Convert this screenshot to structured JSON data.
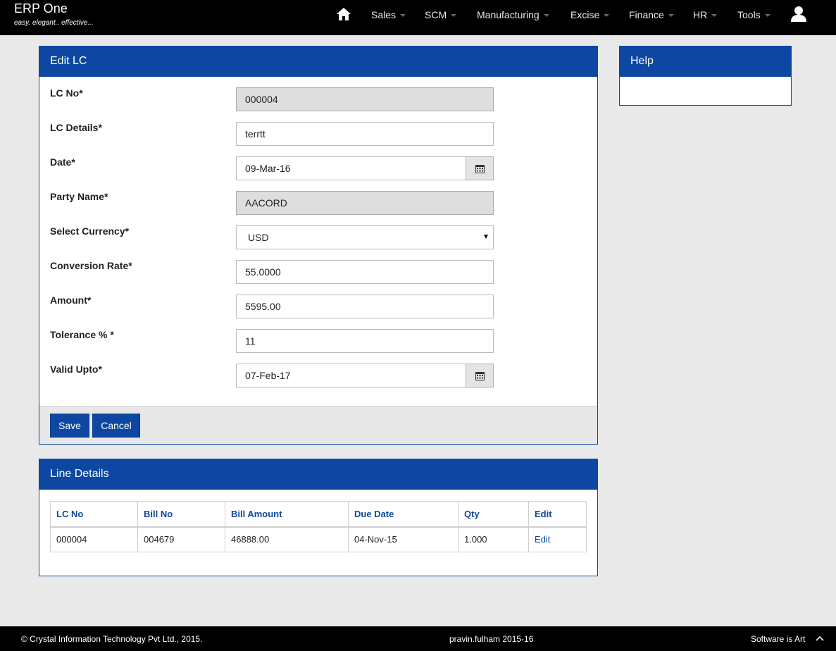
{
  "app": {
    "title": "ERP One",
    "tagline": "easy. elegant.. effective..."
  },
  "nav": {
    "items": [
      {
        "label": "Sales"
      },
      {
        "label": "SCM"
      },
      {
        "label": "Manufacturing"
      },
      {
        "label": "Excise"
      },
      {
        "label": "Finance"
      },
      {
        "label": "HR"
      },
      {
        "label": "Tools"
      }
    ]
  },
  "edit_panel": {
    "title": "Edit LC",
    "fields": {
      "lc_no": {
        "label": "LC No*",
        "value": "000004"
      },
      "lc_details": {
        "label": "LC Details*",
        "value": "terrtt"
      },
      "date": {
        "label": "Date*",
        "value": "09-Mar-16"
      },
      "party_name": {
        "label": "Party Name*",
        "value": "AACORD"
      },
      "currency": {
        "label": "Select Currency*",
        "value": "USD"
      },
      "conversion_rate": {
        "label": "Conversion Rate*",
        "value": "55.0000"
      },
      "amount": {
        "label": "Amount*",
        "value": "5595.00"
      },
      "tolerance": {
        "label": "Tolerance % *",
        "value": "11"
      },
      "valid_upto": {
        "label": "Valid Upto*",
        "value": "07-Feb-17"
      }
    },
    "save_label": "Save",
    "cancel_label": "Cancel"
  },
  "help_panel": {
    "title": "Help"
  },
  "lines_panel": {
    "title": "Line Details",
    "columns": [
      "LC No",
      "Bill No",
      "Bill Amount",
      "Due Date",
      "Qty",
      "Edit"
    ],
    "rows": [
      {
        "lc_no": "000004",
        "bill_no": "004679",
        "bill_amount": "46888.00",
        "due_date": "04-Nov-15",
        "qty": "1.000",
        "edit": "Edit"
      }
    ]
  },
  "footer": {
    "copyright": "© Crystal Information Technology Pvt Ltd., 2015.",
    "user": "pravin.fulham 2015-16",
    "slogan": "Software is Art"
  },
  "colors": {
    "brand": "#0d47a1",
    "navbar": "#000000",
    "background": "#e9e9e9"
  },
  "icons": {
    "home": "home-icon",
    "user": "user-icon",
    "calendar": "calendar-icon",
    "scroll_top": "chevron-up-icon"
  }
}
